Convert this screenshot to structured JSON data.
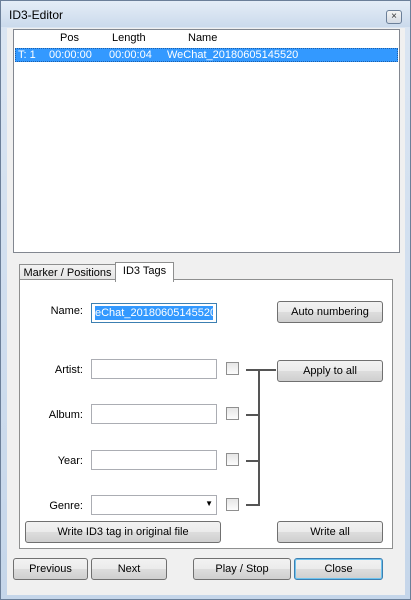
{
  "window": {
    "title": "ID3-Editor",
    "close_glyph": "×"
  },
  "listview": {
    "columns": [
      "Pos",
      "Length",
      "Name"
    ],
    "rows": [
      {
        "track": "T: 1",
        "pos": "00:00:00",
        "length": "00:00:04",
        "name": "WeChat_20180605145520"
      }
    ]
  },
  "tabs": [
    {
      "label": "Marker / Positions",
      "active": false
    },
    {
      "label": "ID3 Tags",
      "active": true
    }
  ],
  "form": {
    "name_label": "Name:",
    "name_value": "eChat_20180605145520",
    "artist_label": "Artist:",
    "artist_value": "",
    "album_label": "Album:",
    "album_value": "",
    "year_label": "Year:",
    "year_value": "",
    "genre_label": "Genre:",
    "genre_value": "",
    "combo_arrow": "▼"
  },
  "buttons": {
    "auto_numbering": "Auto numbering",
    "apply_to_all": "Apply to all",
    "write_original": "Write ID3 tag in original file",
    "write_all": "Write all",
    "previous": "Previous",
    "next": "Next",
    "play_stop": "Play / Stop",
    "close": "Close"
  }
}
